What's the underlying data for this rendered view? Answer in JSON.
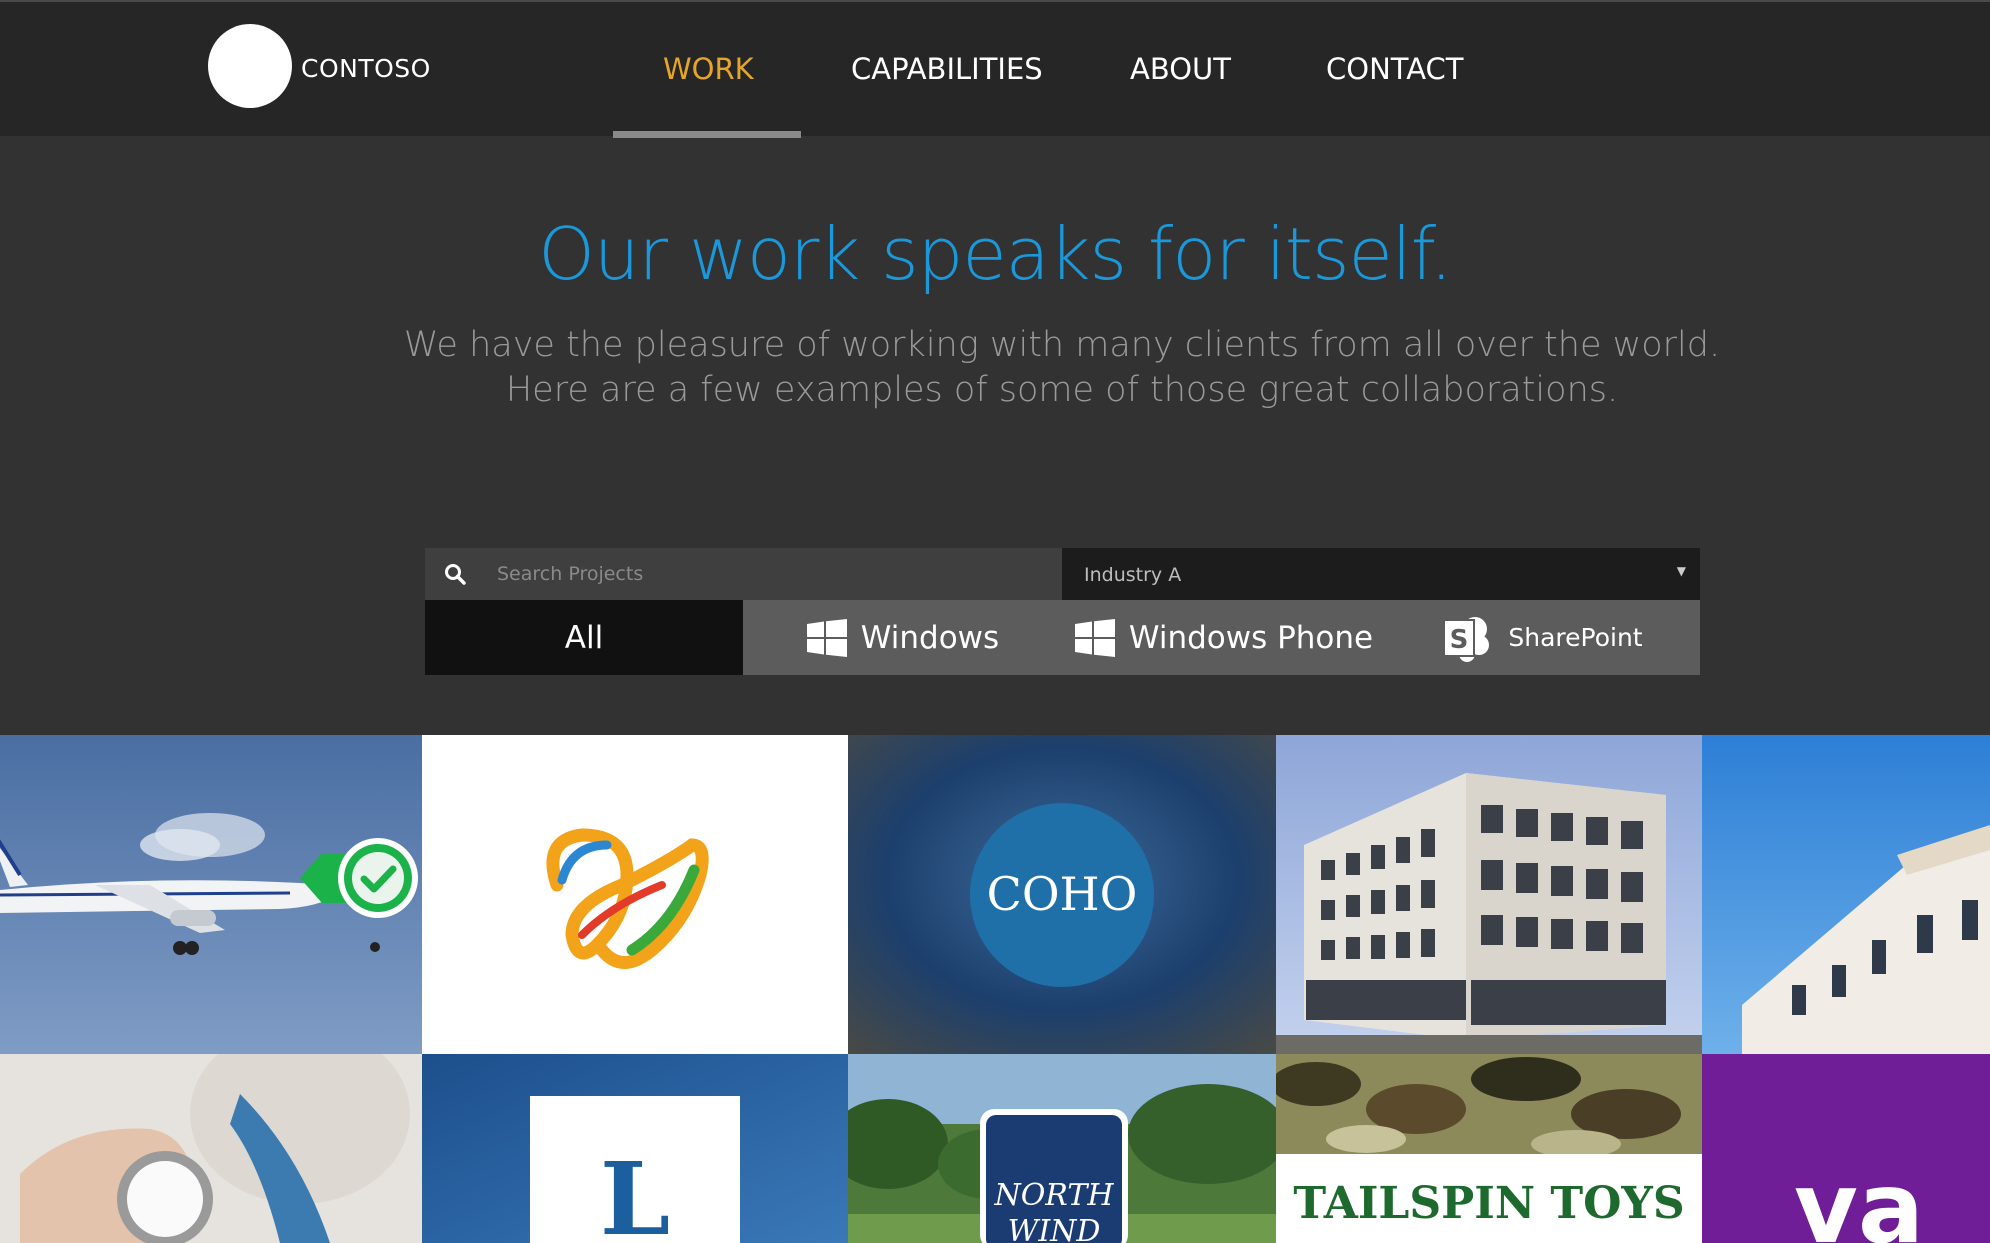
{
  "header": {
    "logo_text": "CONTOSO",
    "nav": [
      {
        "label": "WORK",
        "active": true
      },
      {
        "label": "CAPABILITIES",
        "active": false
      },
      {
        "label": "ABOUT",
        "active": false
      },
      {
        "label": "CONTACT",
        "active": false
      }
    ]
  },
  "hero": {
    "headline": "Our work speaks for itself.",
    "subline_1": "We have the pleasure of working with many clients from all over the world.",
    "subline_2": "Here are a few examples of some of those great collaborations."
  },
  "filters": {
    "search_placeholder": "Search Projects",
    "industry_selected": "Industry A",
    "tabs": [
      {
        "label": "All",
        "active": true,
        "icon": "none"
      },
      {
        "label": "Windows",
        "active": false,
        "icon": "windows-icon"
      },
      {
        "label": "Windows Phone",
        "active": false,
        "icon": "windows-icon"
      },
      {
        "label": "SharePoint",
        "active": false,
        "icon": "sharepoint-icon"
      }
    ]
  },
  "tiles": {
    "coho": "COHO",
    "lucerne_letter": "L",
    "northwind_1": "NORTH",
    "northwind_2": "WIND",
    "tailspin": "TAILSPIN TOYS",
    "purple_text": "va"
  },
  "colors": {
    "accent_blue": "#1b98da",
    "nav_active": "#e5a526",
    "header_bg": "#262626",
    "page_bg": "#323232",
    "check_green": "#1bb24a",
    "purple": "#6f1e97"
  }
}
